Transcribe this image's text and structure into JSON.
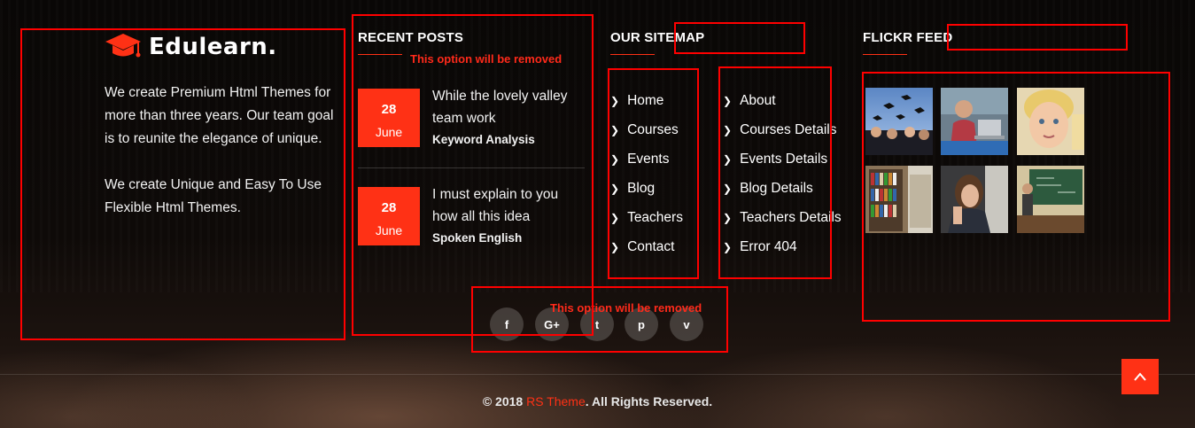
{
  "brand": {
    "logo_text": "Edulearn.",
    "about_paragraphs": [
      "We create Premium Html Themes for more than three years. Our team goal is to reunite the elegance of unique.",
      "We create Unique and Easy To Use Flexible Html Themes."
    ]
  },
  "recent_posts": {
    "title": "RECENT POSTS",
    "note": "This option will be removed",
    "posts": [
      {
        "day": "28",
        "month": "June",
        "title": "While the lovely valley team work",
        "category": "Keyword Analysis"
      },
      {
        "day": "28",
        "month": "June",
        "title": "I must explain to you how all this idea",
        "category": "Spoken English"
      }
    ]
  },
  "sitemap": {
    "title": "OUR SITEMAP",
    "col1": [
      "Home",
      "Courses",
      "Events",
      "Blog",
      "Teachers",
      "Contact"
    ],
    "col2": [
      "About",
      "Courses Details",
      "Events Details",
      "Blog Details",
      "Teachers Details",
      "Error 404"
    ]
  },
  "flickr": {
    "title": "FLICKR FEED",
    "images": [
      "graduation-caps",
      "student-laptop",
      "child-portrait",
      "library-shelves",
      "student-thinking",
      "classroom-blackboard"
    ]
  },
  "social": {
    "note": "This option will be removed",
    "icons": [
      {
        "name": "facebook-icon",
        "glyph": "f"
      },
      {
        "name": "google-plus-icon",
        "glyph": "G+"
      },
      {
        "name": "twitter-icon",
        "glyph": "t"
      },
      {
        "name": "pinterest-icon",
        "glyph": "p"
      },
      {
        "name": "vimeo-icon",
        "glyph": "v"
      }
    ]
  },
  "footer": {
    "copyright_prefix": "© 2018",
    "copyright_brand": "RS Theme",
    "copyright_suffix": ". All Rights Reserved."
  },
  "colors": {
    "accent": "#ff3115",
    "annotation": "#ff0000"
  }
}
